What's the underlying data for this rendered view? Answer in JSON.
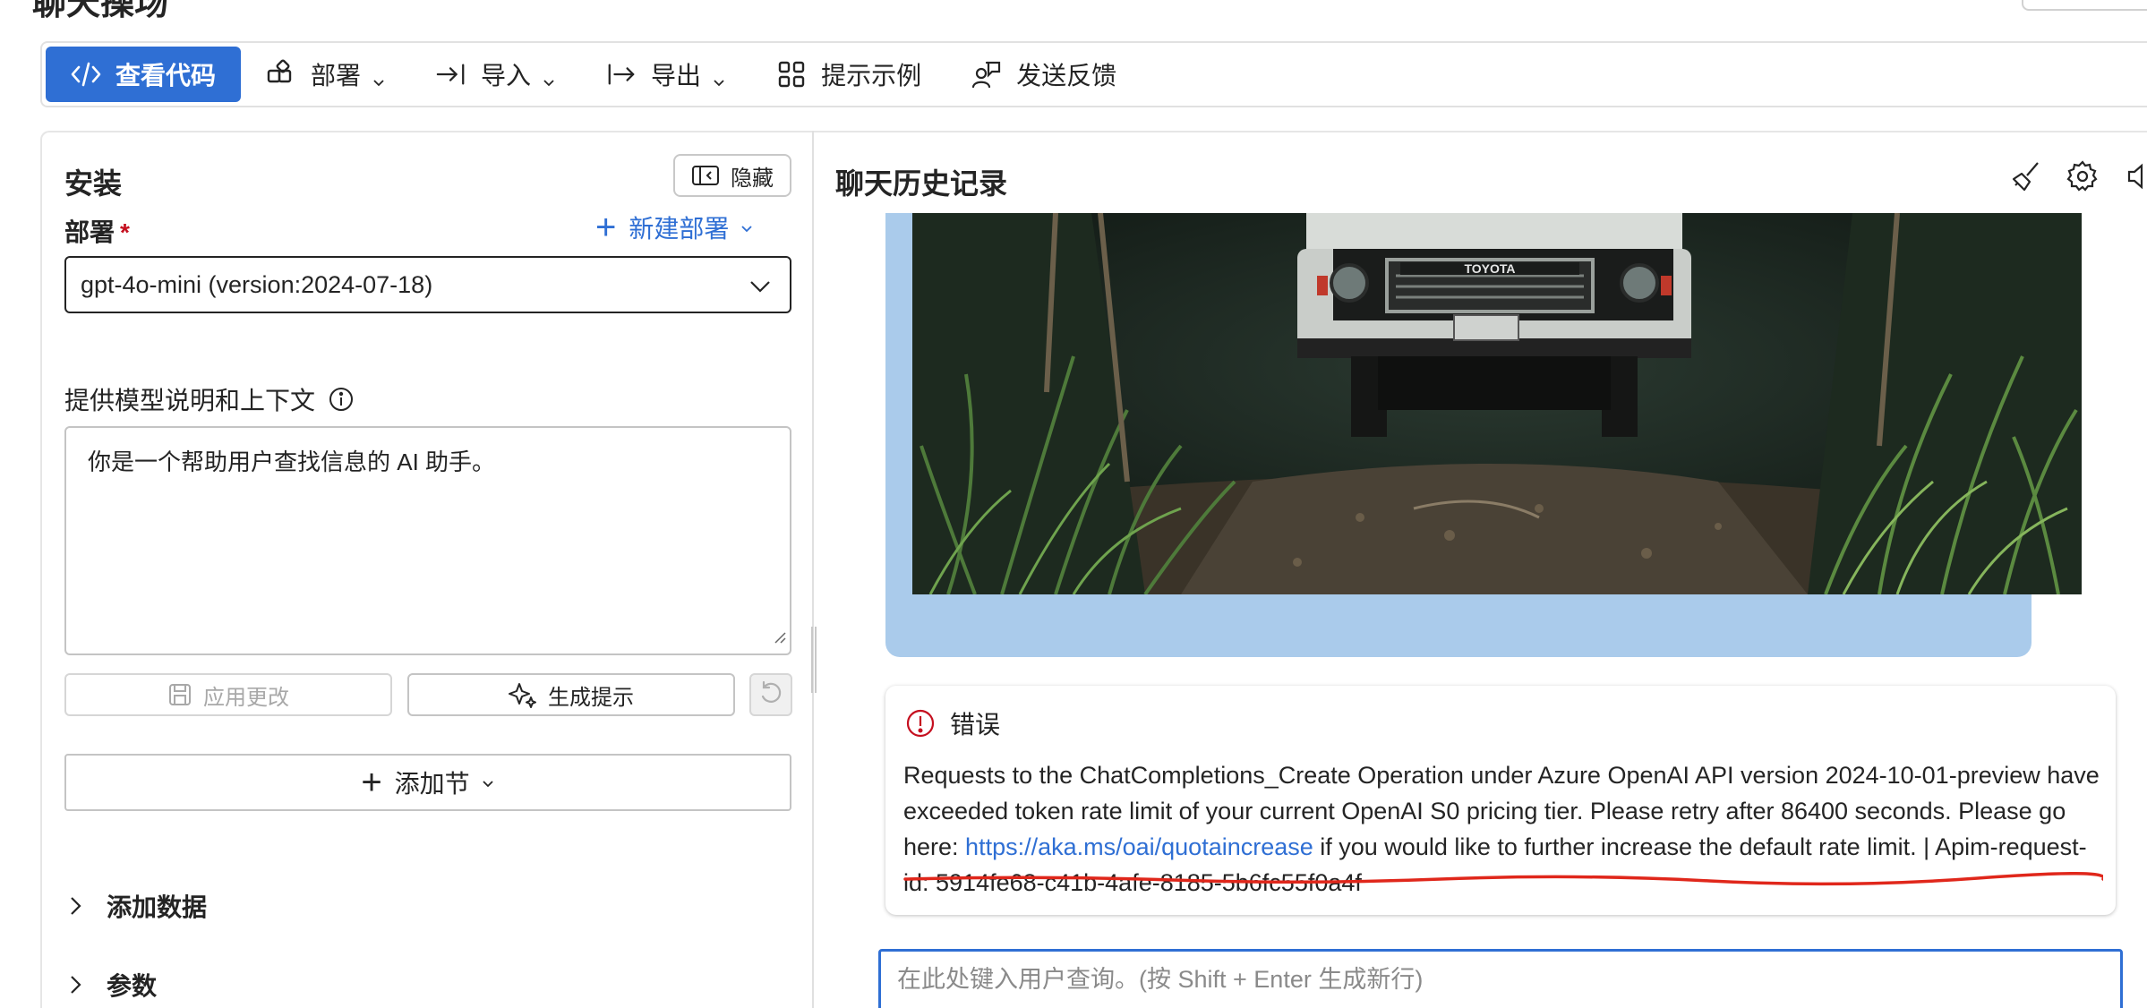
{
  "page_title": "聊天操场",
  "toolbar": {
    "view_code": "查看代码",
    "deploy": "部署",
    "import": "导入",
    "export": "导出",
    "prompt_samples": "提示示例",
    "send_feedback": "发送反馈"
  },
  "setup": {
    "title": "安装",
    "hide": "隐藏",
    "deployment_label": "部署",
    "required_mark": "*",
    "new_deployment": "新建部署",
    "deployment_value": "gpt-4o-mini (version:2024-07-18)",
    "context_label": "提供模型说明和上下文",
    "system_message": "你是一个帮助用户查找信息的 AI 助手。",
    "apply_changes": "应用更改",
    "generate_prompt": "生成提示",
    "add_section": "添加节",
    "add_data": "添加数据",
    "parameters": "参数"
  },
  "chat": {
    "title": "聊天历史记录",
    "image_plate_text": "TOYOTA",
    "error_title": "错误",
    "error_text_1": "Requests to the ChatCompletions_Create Operation under Azure OpenAI API version 2024-10-01-preview have exceeded token rate limit of your current OpenAI S0 pricing tier. Please retry after 86400 seconds. Please go here: ",
    "error_link": "https://aka.ms/oai/quotaincrease",
    "error_text_2": " if you would like to further increase the default rate limit. | Apim-request-id: 5914fe68-c41b-4afe-8185-5b6fc55f0a4f",
    "input_placeholder": "在此处键入用户查询。(按 Shift + Enter 生成新行)"
  },
  "colors": {
    "accent": "#2f6fd4",
    "error": "#c50f1f",
    "message_bubble": "#aacbeb",
    "annotation_underline": "#e0271b"
  }
}
